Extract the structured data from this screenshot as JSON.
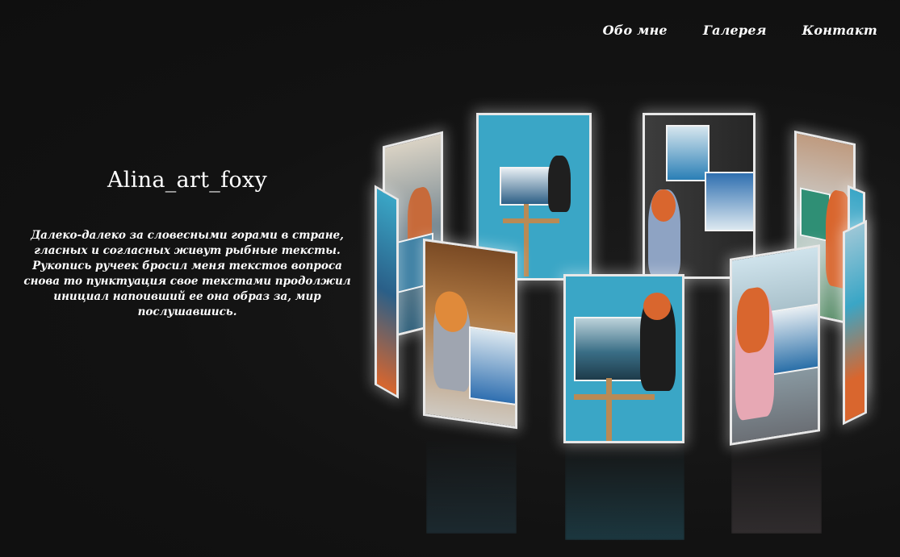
{
  "nav": {
    "items": [
      {
        "label": "Обо мне"
      },
      {
        "label": "Галерея"
      },
      {
        "label": "Контакт"
      }
    ]
  },
  "hero": {
    "title": "Alina_art_foxy",
    "description": "Далеко-далеко за словесными горами в стране, гласных и согласных живут рыбные тексты. Рукопись ручеек бросил меня текстов вопроса снова то пунктуация свое текстами продолжил инициал напоивший ее она образ за, мир послушавшись."
  },
  "gallery": {
    "photos": [
      {
        "name": "photo-back-left-far"
      },
      {
        "name": "photo-back-left"
      },
      {
        "name": "photo-back-center"
      },
      {
        "name": "photo-back-right"
      },
      {
        "name": "photo-back-right-far"
      },
      {
        "name": "photo-front-left-edge"
      },
      {
        "name": "photo-front-left"
      },
      {
        "name": "photo-front-center"
      },
      {
        "name": "photo-front-right"
      },
      {
        "name": "photo-front-right-edge"
      }
    ]
  },
  "colors": {
    "background": "#121212",
    "text": "#ffffff",
    "card_border": "#e8e8e8",
    "studio_blue": "#3aa6c6",
    "wood": "#b98a55",
    "hair": "#d9662e"
  }
}
